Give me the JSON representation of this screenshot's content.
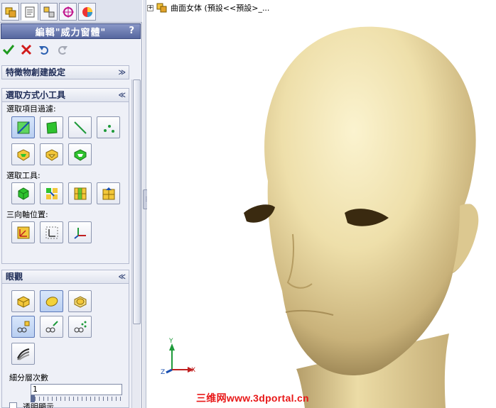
{
  "panel": {
    "tabs": [
      {
        "icon": "feature-manager-icon"
      },
      {
        "icon": "property-manager-icon"
      },
      {
        "icon": "configuration-manager-icon"
      },
      {
        "icon": "dimxpert-icon"
      },
      {
        "icon": "display-manager-icon"
      }
    ],
    "title": "編輯\"威力窗體\"",
    "help": "?",
    "actions": [
      {
        "icon": "ok-checkmark-icon",
        "color": "#1f9a1f"
      },
      {
        "icon": "cancel-x-icon",
        "color": "#d01a1a"
      },
      {
        "icon": "undo-icon"
      },
      {
        "icon": "redo-icon"
      }
    ]
  },
  "groups": {
    "feature_creation": {
      "title": "特徵物創建設定",
      "chevron": "≫"
    },
    "selection_tools": {
      "title": "選取方式小工具",
      "chevron": "≪",
      "filter_label": "選取項目過濾:",
      "tools_label": "選取工具:",
      "triad_label": "三向軸位置:"
    },
    "appearance": {
      "title": "眼觀",
      "chevron": "≪",
      "subdiv_label": "細分層次數",
      "subdiv_value": "1",
      "transparent_label": "透明顯示"
    }
  },
  "viewport": {
    "tree_toggle": "⊞",
    "tree_label": "曲面女体 (預設<<預設>_...",
    "axes": {
      "x": "X",
      "y": "Y",
      "z": "Z"
    },
    "model_color": "#e9dcaa"
  },
  "watermark": "三维网www.3dportal.cn"
}
